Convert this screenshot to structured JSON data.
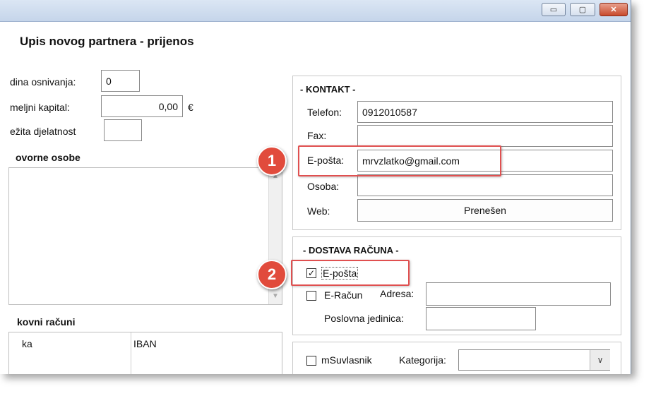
{
  "window": {
    "title_controls": {
      "minimize": "▭",
      "maximize": "▢",
      "close": "✕"
    }
  },
  "form": {
    "title": "Upis novog partnera - prijenos"
  },
  "left": {
    "godina_label": "dina osnivanja:",
    "godina_value": "0",
    "kapital_label": "meljni kapital:",
    "kapital_value": "0,00",
    "kapital_currency": "€",
    "djelatnost_label": "ežita djelatnost",
    "djelatnost_value": "",
    "osobe_heading": "ovorne osobe",
    "racuni_heading": "kovni računi",
    "racuni_columns": [
      "ka",
      "IBAN"
    ]
  },
  "kontakt": {
    "heading": "- KONTAKT -",
    "telefon_label": "Telefon:",
    "telefon_value": "0912010587",
    "fax_label": "Fax:",
    "fax_value": "",
    "eposta_label": "E-pošta:",
    "eposta_value": "mrvzlatko@gmail.com",
    "osoba_label": "Osoba:",
    "osoba_value": "",
    "web_label": "Web:",
    "web_button": "Prenešen"
  },
  "dostava": {
    "heading": "- DOSTAVA RAČUNA -",
    "eposta_checkbox_label": "E-pošta",
    "eposta_checked": true,
    "eracun_checkbox_label": "E-Račun",
    "eracun_checked": false,
    "adresa_label": "Adresa:",
    "adresa_value": "",
    "poslovna_label": "Poslovna jedinica:",
    "poslovna_value": ""
  },
  "bottom": {
    "msuvlasnik_label": "mSuvlasnik",
    "msuvlasnik_checked": false,
    "kategorija_label": "Kategorija:",
    "kategorija_value": ""
  },
  "callouts": {
    "first": "1",
    "second": "2"
  },
  "colors": {
    "callout_red": "#e14b3c",
    "window_border": "#7a8da6"
  }
}
